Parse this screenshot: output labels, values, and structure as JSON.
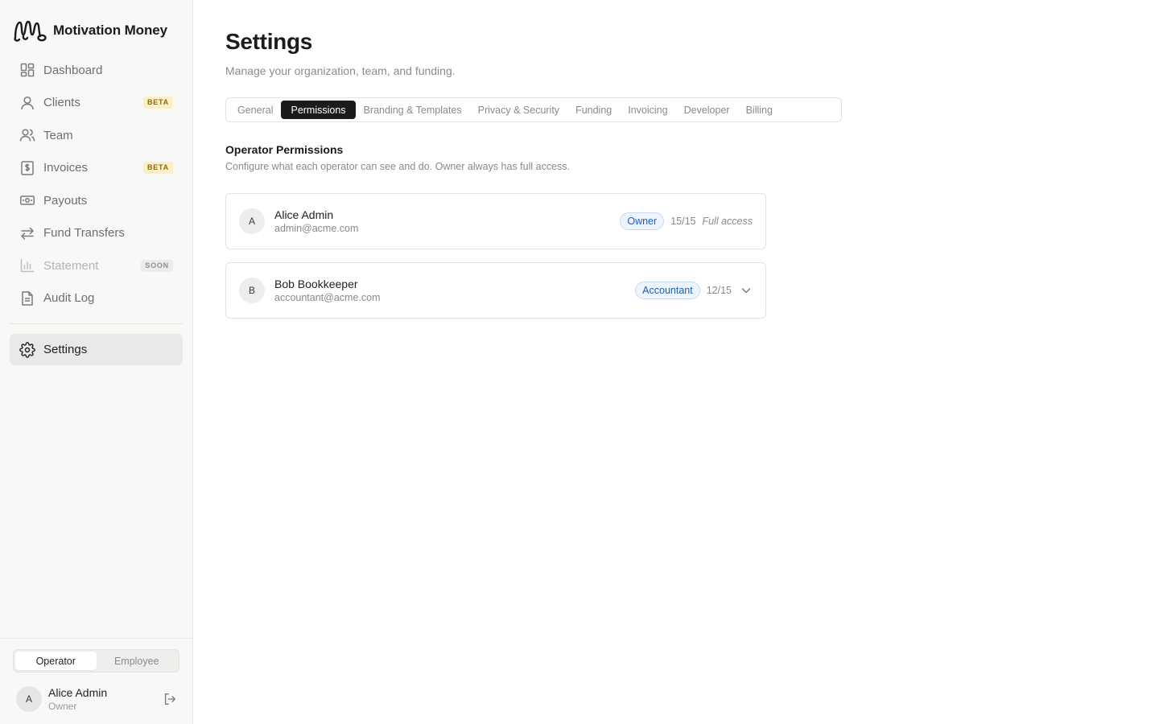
{
  "app": {
    "name": "Motivation Money"
  },
  "sidebar": {
    "items": [
      {
        "label": "Dashboard",
        "icon": "dashboard-grid-icon",
        "badge": ""
      },
      {
        "label": "Clients",
        "icon": "user-icon",
        "badge": "BETA"
      },
      {
        "label": "Team",
        "icon": "users-icon",
        "badge": ""
      },
      {
        "label": "Invoices",
        "icon": "invoice-dollar-icon",
        "badge": "BETA"
      },
      {
        "label": "Payouts",
        "icon": "banknote-icon",
        "badge": ""
      },
      {
        "label": "Fund Transfers",
        "icon": "arrows-left-right-icon",
        "badge": ""
      },
      {
        "label": "Statement",
        "icon": "bar-chart-icon",
        "badge": "SOON",
        "disabled": true
      },
      {
        "label": "Audit Log",
        "icon": "document-icon",
        "badge": ""
      }
    ],
    "settings": {
      "label": "Settings",
      "icon": "gear-icon",
      "active": true
    },
    "mode_toggle": {
      "options": [
        "Operator",
        "Employee"
      ],
      "selected": "Operator"
    },
    "user": {
      "initial": "A",
      "name": "Alice Admin",
      "role": "Owner"
    }
  },
  "page": {
    "title": "Settings",
    "subtitle": "Manage your organization, team, and funding.",
    "tabs": [
      {
        "label": "General"
      },
      {
        "label": "Permissions",
        "active": true
      },
      {
        "label": "Branding & Templates"
      },
      {
        "label": "Privacy & Security"
      },
      {
        "label": "Funding"
      },
      {
        "label": "Invoicing"
      },
      {
        "label": "Developer"
      },
      {
        "label": "Billing"
      }
    ],
    "section": {
      "title": "Operator Permissions",
      "description": "Configure what each operator can see and do. Owner always has full access."
    },
    "operators": [
      {
        "initial": "A",
        "name": "Alice Admin",
        "email": "admin@acme.com",
        "role": "Owner",
        "permissions": "15/15",
        "note": "Full access"
      },
      {
        "initial": "B",
        "name": "Bob Bookkeeper",
        "email": "accountant@acme.com",
        "role": "Accountant",
        "permissions": "12/15",
        "note": ""
      }
    ]
  },
  "colors": {
    "sidebar_bg": "#f8f8f7",
    "active_tab_bg": "#1b1b1b",
    "role_pill_text": "#1e5fb5",
    "beta_badge_bg": "#fbefc4"
  }
}
